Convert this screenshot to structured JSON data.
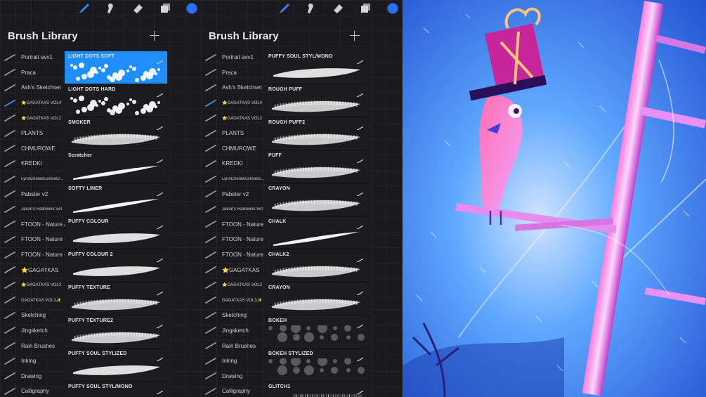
{
  "colors": {
    "accent": "#1f8eff",
    "color_well": "#2d6ff0",
    "panel_bg": "#1a1a1d"
  },
  "tools": [
    {
      "name": "brush-tool-icon"
    },
    {
      "name": "smudge-tool-icon"
    },
    {
      "name": "eraser-tool-icon"
    },
    {
      "name": "layers-icon"
    },
    {
      "name": "color-picker"
    }
  ],
  "panels": [
    {
      "title": "Brush Library",
      "sets": [
        {
          "label": "Portrait avv1"
        },
        {
          "label": "Praca"
        },
        {
          "label": "Ash's Sketchset"
        },
        {
          "label": "⭐GAGATKAS VOL4",
          "small": true,
          "active": true
        },
        {
          "label": "⭐GAGATKAS VOL2",
          "small": true
        },
        {
          "label": "PLANTS"
        },
        {
          "label": "CHMUROWE"
        },
        {
          "label": "KREDKI"
        },
        {
          "label": "LynnChenBrushSet2...",
          "small": true
        },
        {
          "label": "Pabster v2"
        },
        {
          "label": "Jason's Hallowink Set",
          "small": true
        },
        {
          "label": "FTOON - Nature A"
        },
        {
          "label": "FTOON - Nature B"
        },
        {
          "label": "FTOON - Nature C"
        },
        {
          "label": "⭐GAGATKAS"
        },
        {
          "label": "⭐GAGATKAS VOL2",
          "small": true
        },
        {
          "label": "GAGATKAS VOL3✨",
          "small": true
        },
        {
          "label": "Sketching"
        },
        {
          "label": "Jingsketch"
        },
        {
          "label": "Rain Brushes"
        },
        {
          "label": "Inking"
        },
        {
          "label": "Drawing"
        },
        {
          "label": "Calligraphy"
        }
      ],
      "brushes": [
        {
          "label": "LIGHT DOTS SOFT",
          "selected": true
        },
        {
          "label": "LIGHT DOTS  HARD"
        },
        {
          "label": "SMOKER"
        },
        {
          "label": "Scratcher"
        },
        {
          "label": "SOFTY LINER"
        },
        {
          "label": "PUFFY COLOUR"
        },
        {
          "label": "PUFFY COLOUR 2"
        },
        {
          "label": "PUFFY TEXTURE"
        },
        {
          "label": "PUFFY TEXTURE2"
        },
        {
          "label": "PUFFY SOUL STYLIZED"
        },
        {
          "label": "PUFFY SOUL STYL/MONO"
        }
      ]
    },
    {
      "title": "Brush Library",
      "sets": [
        {
          "label": "Portrait avv1"
        },
        {
          "label": "Praca"
        },
        {
          "label": "Ash's Sketchset"
        },
        {
          "label": "⭐GAGATKAS VOL4",
          "small": true,
          "active": true
        },
        {
          "label": "⭐GAGATKAS VOL2",
          "small": true
        },
        {
          "label": "PLANTS"
        },
        {
          "label": "CHMUROWE"
        },
        {
          "label": "KREDKI"
        },
        {
          "label": "LynnChenBrushSet2...",
          "small": true
        },
        {
          "label": "Pabster v2"
        },
        {
          "label": "Jason's Hallowink Set",
          "small": true
        },
        {
          "label": "FTOON - Nature A"
        },
        {
          "label": "FTOON - Nature B"
        },
        {
          "label": "FTOON - Nature C"
        },
        {
          "label": "⭐GAGATKAS"
        },
        {
          "label": "⭐GAGATKAS VOL2",
          "small": true
        },
        {
          "label": "GAGATKAS VOL3✨",
          "small": true
        },
        {
          "label": "Sketching"
        },
        {
          "label": "Jingsketch"
        },
        {
          "label": "Rain Brushes"
        },
        {
          "label": "Inking"
        },
        {
          "label": "Drawing"
        },
        {
          "label": "Calligraphy"
        }
      ],
      "brushes": [
        {
          "label": "PUFFY SOUL STYL/MONO"
        },
        {
          "label": "ROUGH PUFF"
        },
        {
          "label": "ROUGH PUFF2"
        },
        {
          "label": "PUFF"
        },
        {
          "label": "CRAYON"
        },
        {
          "label": "CHALK"
        },
        {
          "label": "CHALK2"
        },
        {
          "label": "CRAYON"
        },
        {
          "label": "BOKEH"
        },
        {
          "label": "BOKEH STYLIZED"
        },
        {
          "label": "GLITCH1"
        }
      ]
    }
  ]
}
